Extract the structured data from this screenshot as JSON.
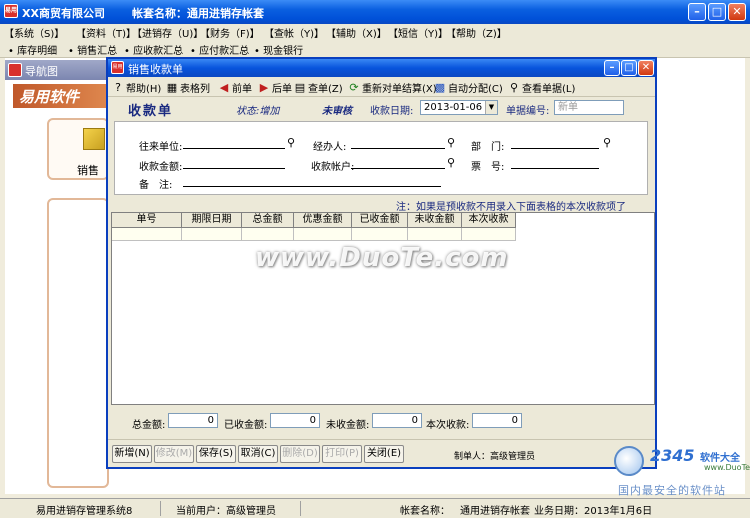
{
  "main": {
    "company": "XX商贸有限公司",
    "account_label": "帐套名称：通用进销存帐套"
  },
  "menu": [
    "【系统（S)】",
    "【资料（T)】",
    "【进销存（U)】",
    "【财务（F)】",
    "【查帐（Y)】",
    "【辅助（X)】",
    "【短信（Y)】",
    "【帮助（Z)】"
  ],
  "quick": [
    "• 库存明细",
    "• 销售汇总",
    "• 应收款汇总",
    "• 应付款汇总",
    "• 现金银行"
  ],
  "nav": {
    "title": "导航图",
    "banner": "易用软件",
    "sales_label": "销售"
  },
  "receipt": {
    "title": "销售收款单",
    "toolbar": [
      "帮助(H)",
      "表格列",
      "前单",
      "后单",
      "查单(Z)",
      "重新对单结算(X)",
      "自动分配(C)",
      "查看单据(L)"
    ],
    "heading": "收款单",
    "status": "状态:增加",
    "audit": "未审核",
    "date_label": "收款日期:",
    "date_value": "2013-01-06",
    "billno_label": "单据编号:",
    "billno_value": "新单",
    "fields": {
      "customer": "往来单位:",
      "handler": "经办人:",
      "dept": "部　门:",
      "amount": "收款金额:",
      "account": "收款帐户:",
      "ticket": "票　号:",
      "memo": "备　注:"
    },
    "note": "注：如果是预收款不用录入下面表格的本次收款项了",
    "columns": [
      "单号",
      "期限日期",
      "总金额",
      "优惠金额",
      "已收金额",
      "未收金额",
      "本次收款"
    ],
    "totals": {
      "total_label": "总金额:",
      "total": "0",
      "received_label": "已收金额:",
      "received": "0",
      "unreceived_label": "未收金额:",
      "unreceived": "0",
      "current_label": "本次收款:",
      "current": "0"
    },
    "buttons": [
      "新增(N)",
      "修改(M)",
      "保存(S)",
      "取消(C)",
      "删除(D)",
      "打印(P)",
      "关闭(E)"
    ],
    "maker": "制单人：高级管理员"
  },
  "watermark": "www.DuoTe.com",
  "status": {
    "system": "易用进销存管理系统8",
    "user": "当前用户：高级管理员",
    "account_label": "帐套名称：",
    "account_value": "通用进销存帐套",
    "date": "业务日期：2013年1月6日"
  },
  "brand": {
    "num": "2345",
    "cn": "软件大全",
    "url": "www.DuoTe.com",
    "slogan": "国内最安全的软件站"
  }
}
